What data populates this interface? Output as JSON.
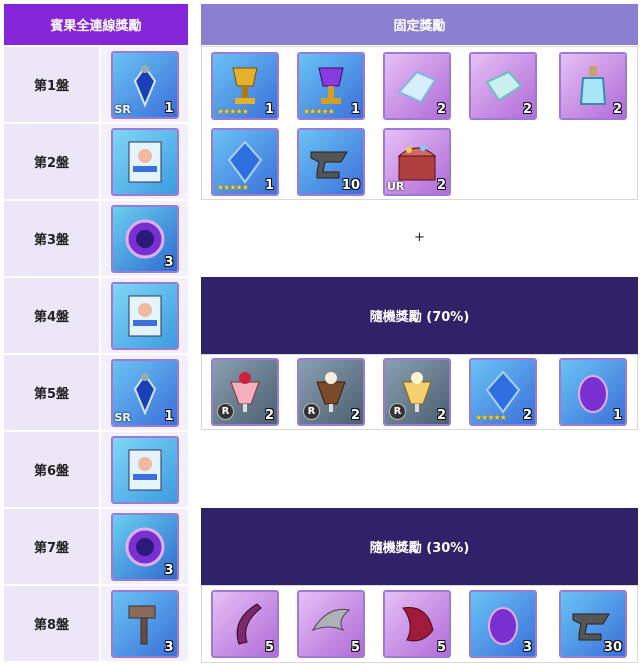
{
  "left": {
    "header": "賓果全連線獎勵",
    "rows": [
      {
        "name": "第1盤",
        "icon": "blue-pendant-icon",
        "qty": "1",
        "grade": "SR"
      },
      {
        "name": "第2盤",
        "icon": "card-pack-icon",
        "qty": "",
        "grade": ""
      },
      {
        "name": "第3盤",
        "icon": "purple-orb-icon",
        "qty": "3",
        "grade": ""
      },
      {
        "name": "第4盤",
        "icon": "card-pack-icon",
        "qty": "",
        "grade": ""
      },
      {
        "name": "第5盤",
        "icon": "blue-pendant-icon",
        "qty": "1",
        "grade": "SR"
      },
      {
        "name": "第6盤",
        "icon": "card-pack-icon",
        "qty": "",
        "grade": ""
      },
      {
        "name": "第7盤",
        "icon": "purple-orb-icon",
        "qty": "3",
        "grade": ""
      },
      {
        "name": "第8盤",
        "icon": "hammer-icon",
        "qty": "3",
        "grade": ""
      }
    ]
  },
  "right": {
    "header": "固定獎勵",
    "fixed_row1": [
      {
        "icon": "gold-trophy-icon",
        "qty": "1",
        "stars": "★★★★★"
      },
      {
        "icon": "purple-trophy-icon",
        "qty": "1",
        "stars": "★★★★★"
      },
      {
        "icon": "crystal-shard-icon",
        "qty": "2",
        "stars": ""
      },
      {
        "icon": "crystal-slab-icon",
        "qty": "2",
        "stars": ""
      },
      {
        "icon": "potion-bottle-icon",
        "qty": "2",
        "stars": ""
      }
    ],
    "fixed_row2": [
      {
        "icon": "blue-crystal-icon",
        "qty": "1",
        "stars": "★★★★★"
      },
      {
        "icon": "anvil-icon",
        "qty": "10",
        "stars": ""
      },
      {
        "icon": "treasure-chest-icon",
        "qty": "2",
        "stars": "",
        "grade": "UR"
      }
    ],
    "plus": "+",
    "random70_label": "隨機獎勵 (70%)",
    "random70_items": [
      {
        "icon": "strawberry-parfait-icon",
        "qty": "2",
        "mark": "R"
      },
      {
        "icon": "chocolate-parfait-icon",
        "qty": "2",
        "mark": "R"
      },
      {
        "icon": "mango-parfait-icon",
        "qty": "2",
        "mark": "R"
      },
      {
        "icon": "blue-crystal-icon",
        "qty": "2",
        "stars": "★★★★★"
      },
      {
        "icon": "purple-gem-icon",
        "qty": "1"
      }
    ],
    "random30_label": "隨機獎勵 (30%)",
    "random30_items": [
      {
        "icon": "horn-icon",
        "qty": "5"
      },
      {
        "icon": "wing-icon",
        "qty": "5"
      },
      {
        "icon": "red-scale-icon",
        "qty": "5"
      },
      {
        "icon": "purple-gem-icon",
        "qty": "3"
      },
      {
        "icon": "anvil-icon",
        "qty": "30"
      }
    ]
  },
  "colors": {
    "left_header": "#8526d9",
    "right_header": "#8b7fd1",
    "dark_bar": "#2f2268",
    "row_bg": "#ece6f7"
  }
}
